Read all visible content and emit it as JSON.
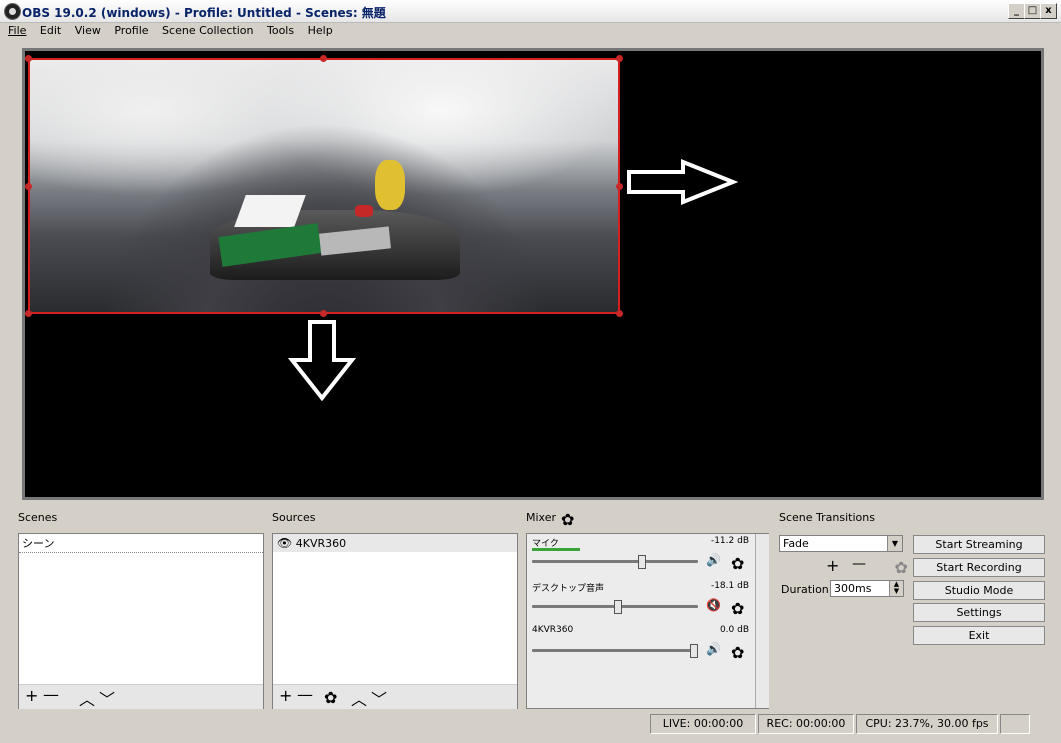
{
  "window": {
    "title": "OBS 19.0.2 (windows) - Profile: Untitled - Scenes: 無題",
    "min_label": "_",
    "max_label": "□",
    "close_label": "x"
  },
  "menu": [
    "File",
    "Edit",
    "View",
    "Profile",
    "Scene Collection",
    "Tools",
    "Help"
  ],
  "docks": {
    "scenes": {
      "title": "Scenes",
      "items": [
        "シーン"
      ]
    },
    "sources": {
      "title": "Sources",
      "items": [
        "4KVR360"
      ]
    },
    "mixer": {
      "title": "Mixer",
      "channels": [
        {
          "name": "マイク",
          "level": "-11.2 dB",
          "muted": false,
          "volume": 0.82
        },
        {
          "name": "デスクトップ音声",
          "level": "-18.1 dB",
          "muted": true,
          "volume": 0.6
        },
        {
          "name": "4KVR360",
          "level": "0.0 dB",
          "muted": false,
          "volume": 1.0
        }
      ]
    },
    "transitions": {
      "title": "Scene Transitions",
      "selected": "Fade",
      "duration_label": "Duration",
      "duration_value": "300ms"
    }
  },
  "controls": [
    "Start Streaming",
    "Start Recording",
    "Studio Mode",
    "Settings",
    "Exit"
  ],
  "status": {
    "live": "LIVE: 00:00:00",
    "rec": "REC: 00:00:00",
    "cpu": "CPU: 23.7%, 30.00 fps"
  },
  "colors": {
    "selection_border": "#d42020",
    "meter_green": "#3aa33a",
    "mute_red": "#d02020"
  }
}
